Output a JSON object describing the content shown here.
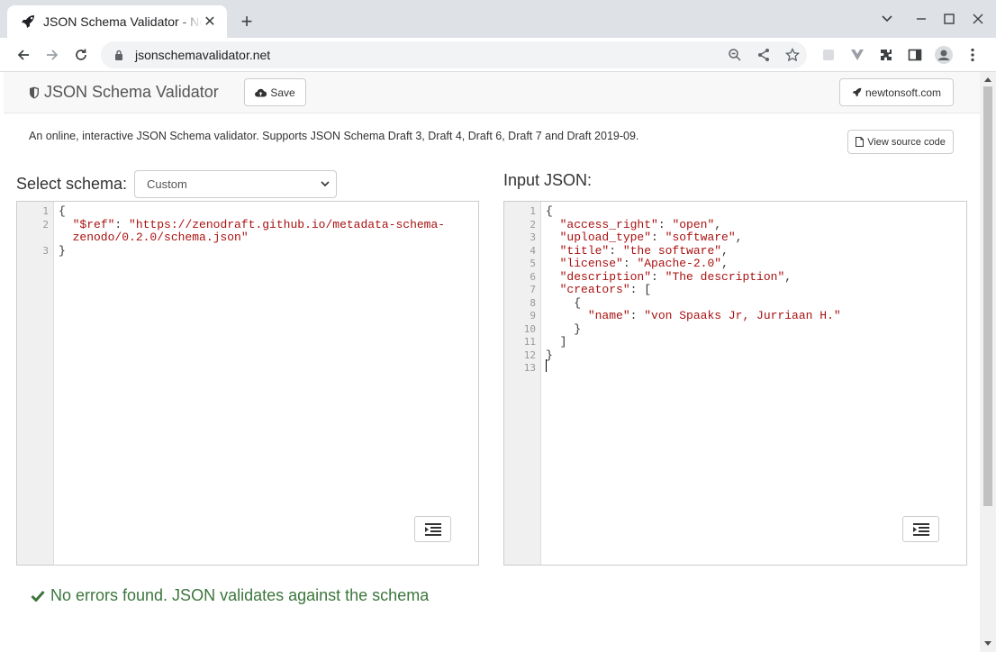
{
  "browser": {
    "tab_title": "JSON Schema Validator - Newtonsoft",
    "url": "jsonschemavalidator.net"
  },
  "navbar": {
    "brand": "JSON Schema Validator",
    "save_label": "Save",
    "newtonsoft_label": "newtonsoft.com"
  },
  "description": "An online, interactive JSON Schema validator. Supports JSON Schema Draft 3, Draft 4, Draft 6, Draft 7 and Draft 2019-09.",
  "view_source_label": "View source code",
  "schema": {
    "label": "Select schema:",
    "selected": "Custom",
    "line_numbers": [
      "1",
      "2",
      "",
      "3"
    ],
    "lines": [
      [
        {
          "t": "{",
          "c": "p"
        }
      ],
      [
        {
          "t": "  ",
          "c": "p"
        },
        {
          "t": "\"$ref\"",
          "c": "k"
        },
        {
          "t": ": ",
          "c": "p"
        },
        {
          "t": "\"https://zenodraft.github.io/metadata-schema-",
          "c": "s"
        }
      ],
      [
        {
          "t": "  zenodo/0.2.0/schema.json\"",
          "c": "s"
        }
      ],
      [
        {
          "t": "}",
          "c": "p"
        }
      ]
    ]
  },
  "input": {
    "label": "Input JSON:",
    "line_numbers": [
      "1",
      "2",
      "3",
      "4",
      "5",
      "6",
      "7",
      "8",
      "9",
      "10",
      "11",
      "12",
      "13"
    ],
    "lines": [
      [
        {
          "t": "{",
          "c": "p"
        }
      ],
      [
        {
          "t": "  ",
          "c": "p"
        },
        {
          "t": "\"access_right\"",
          "c": "k"
        },
        {
          "t": ": ",
          "c": "p"
        },
        {
          "t": "\"open\"",
          "c": "s"
        },
        {
          "t": ",",
          "c": "p"
        }
      ],
      [
        {
          "t": "  ",
          "c": "p"
        },
        {
          "t": "\"upload_type\"",
          "c": "k"
        },
        {
          "t": ": ",
          "c": "p"
        },
        {
          "t": "\"software\"",
          "c": "s"
        },
        {
          "t": ",",
          "c": "p"
        }
      ],
      [
        {
          "t": "  ",
          "c": "p"
        },
        {
          "t": "\"title\"",
          "c": "k"
        },
        {
          "t": ": ",
          "c": "p"
        },
        {
          "t": "\"the software\"",
          "c": "s"
        },
        {
          "t": ",",
          "c": "p"
        }
      ],
      [
        {
          "t": "  ",
          "c": "p"
        },
        {
          "t": "\"license\"",
          "c": "k"
        },
        {
          "t": ": ",
          "c": "p"
        },
        {
          "t": "\"Apache-2.0\"",
          "c": "s"
        },
        {
          "t": ",",
          "c": "p"
        }
      ],
      [
        {
          "t": "  ",
          "c": "p"
        },
        {
          "t": "\"description\"",
          "c": "k"
        },
        {
          "t": ": ",
          "c": "p"
        },
        {
          "t": "\"The description\"",
          "c": "s"
        },
        {
          "t": ",",
          "c": "p"
        }
      ],
      [
        {
          "t": "  ",
          "c": "p"
        },
        {
          "t": "\"creators\"",
          "c": "k"
        },
        {
          "t": ": [",
          "c": "p"
        }
      ],
      [
        {
          "t": "    {",
          "c": "p"
        }
      ],
      [
        {
          "t": "      ",
          "c": "p"
        },
        {
          "t": "\"name\"",
          "c": "k"
        },
        {
          "t": ": ",
          "c": "p"
        },
        {
          "t": "\"von Spaaks Jr, Jurriaan H.\"",
          "c": "s"
        }
      ],
      [
        {
          "t": "    }",
          "c": "p"
        }
      ],
      [
        {
          "t": "  ]",
          "c": "p"
        }
      ],
      [
        {
          "t": "}",
          "c": "p"
        }
      ],
      [
        {
          "t": "",
          "c": "p"
        }
      ]
    ]
  },
  "result": "No errors found. JSON validates against the schema",
  "colors": {
    "success": "#3c763d",
    "json_key": "#aa1111",
    "json_string": "#aa1111"
  }
}
